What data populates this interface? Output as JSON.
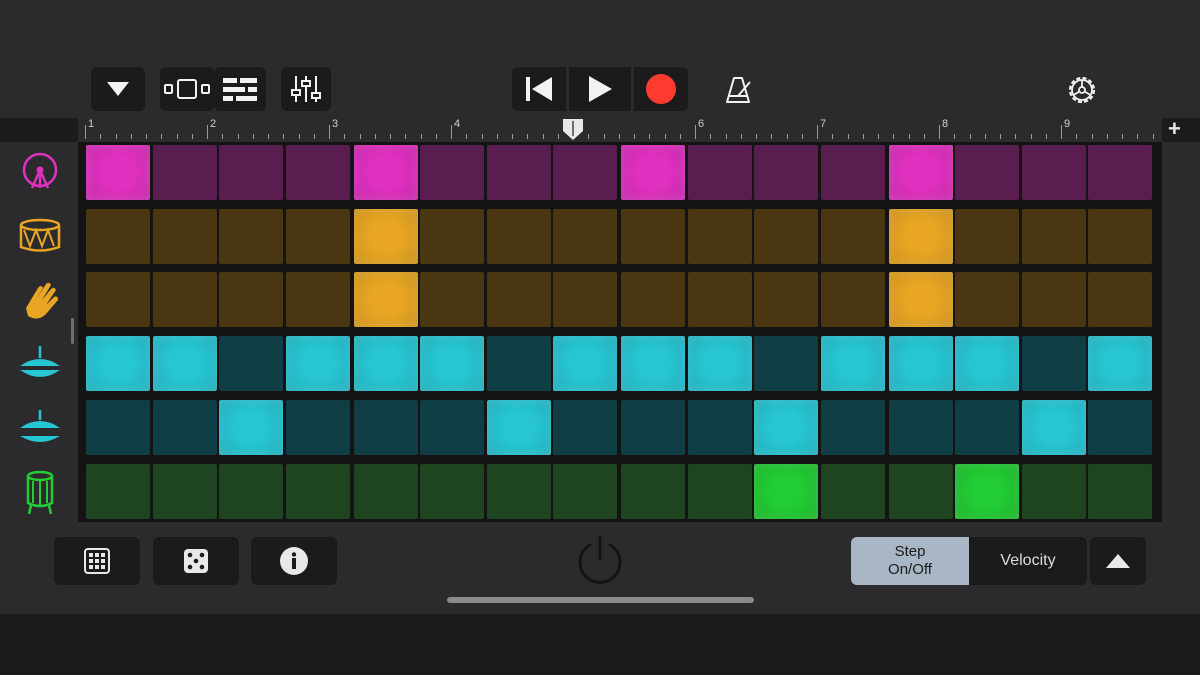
{
  "toolbar": {
    "buttons": [
      "view-dropdown",
      "tracks-view",
      "loop-browser",
      "mixer",
      "rewind",
      "play",
      "record",
      "metronome",
      "settings"
    ],
    "record_color": "#ff3b30"
  },
  "ruler": {
    "bars": [
      "1",
      "2",
      "3",
      "4",
      "5",
      "6",
      "7",
      "8",
      "9"
    ],
    "playhead_bar": 5
  },
  "rows": [
    {
      "icon": "kick-drum-icon",
      "color": "#e030c0",
      "steps": [
        1,
        0,
        0,
        0,
        1,
        0,
        0,
        0,
        1,
        0,
        0,
        0,
        1,
        0,
        0,
        0
      ]
    },
    {
      "icon": "snare-drum-icon",
      "color": "#e8a623",
      "steps": [
        0,
        0,
        0,
        0,
        1,
        0,
        0,
        0,
        0,
        0,
        0,
        0,
        1,
        0,
        0,
        0
      ]
    },
    {
      "icon": "clap-hand-icon",
      "color": "#e8a623",
      "steps": [
        0,
        0,
        0,
        0,
        1,
        0,
        0,
        0,
        0,
        0,
        0,
        0,
        1,
        0,
        0,
        0
      ]
    },
    {
      "icon": "closed-hihat-icon",
      "color": "#27c6d4",
      "steps": [
        1,
        1,
        0,
        1,
        1,
        1,
        0,
        1,
        1,
        1,
        0,
        1,
        1,
        1,
        0,
        1
      ]
    },
    {
      "icon": "open-hihat-icon",
      "color": "#27c6d4",
      "steps": [
        0,
        0,
        1,
        0,
        0,
        0,
        1,
        0,
        0,
        0,
        1,
        0,
        0,
        0,
        1,
        0
      ]
    },
    {
      "icon": "floor-tom-icon",
      "color": "#22cc33",
      "steps": [
        0,
        0,
        0,
        0,
        0,
        0,
        0,
        0,
        0,
        0,
        1,
        0,
        0,
        1,
        0,
        0
      ]
    }
  ],
  "bottom": {
    "step_label_1": "Step",
    "step_label_2": "On/Off",
    "velocity_label": "Velocity"
  },
  "colors": {
    "magenta_on": "#e030c0",
    "magenta_off": "#5a1d4f",
    "amber_on": "#e8a623",
    "amber_off": "#4a3711",
    "cyan_on": "#27c6d4",
    "cyan_off": "#0f3f45",
    "green_on": "#22cc33",
    "green_off": "#1f4520"
  }
}
